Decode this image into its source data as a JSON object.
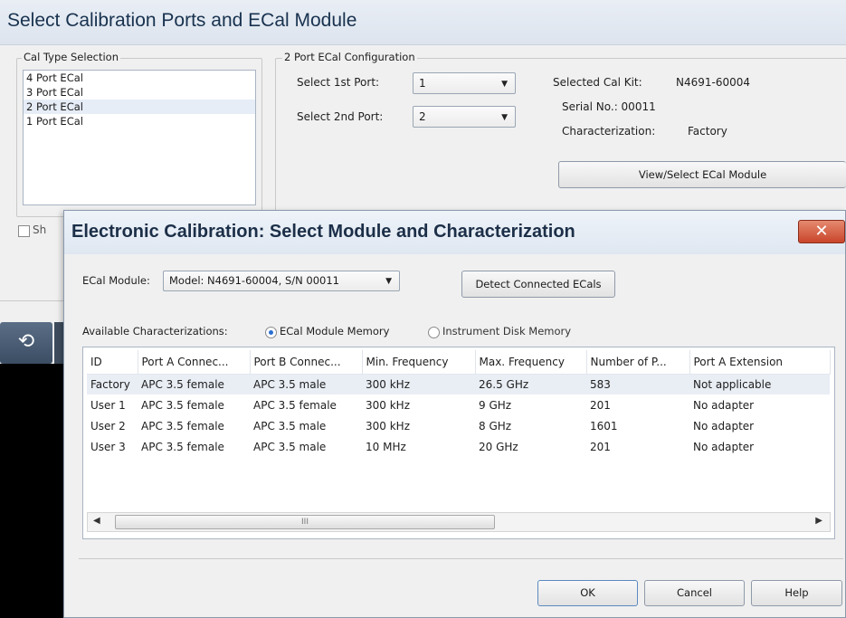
{
  "background_window": {
    "title": "Select Calibration Ports and ECal Module",
    "cal_type_group": {
      "title": "Cal Type Selection",
      "items": [
        "4 Port ECal",
        "3 Port ECal",
        "2 Port ECal",
        "1 Port ECal"
      ],
      "selected_index": 2
    },
    "config_group": {
      "title": "2 Port ECal Configuration",
      "port1_label": "Select 1st Port:",
      "port1_value": "1",
      "port2_label": "Select 2nd Port:",
      "port2_value": "2"
    },
    "cal_kit": {
      "selected_label": "Selected Cal Kit:",
      "selected_value": "N4691-60004",
      "serial_label": "Serial No.: 00011",
      "characterization_label": "Characterization:",
      "characterization_value": "Factory",
      "view_select_button": "View/Select ECal Module"
    },
    "checkbox_label_partial": "Sh"
  },
  "dialog": {
    "title": "Electronic Calibration: Select Module and Characterization",
    "close_glyph": "✕",
    "ecal_module_label": "ECal Module:",
    "ecal_module_value": "Model: N4691-60004, S/N 00011",
    "detect_button": "Detect Connected ECals",
    "available_label": "Available Characterizations:",
    "radio_ecal_memory": "ECal Module Memory",
    "radio_disk_memory": "Instrument Disk Memory",
    "radio_selected": "ECal Module Memory",
    "table": {
      "columns": [
        "ID",
        "Port A Connec...",
        "Port B Connec...",
        "Min. Frequency",
        "Max. Frequency",
        "Number of P...",
        "Port A Extension"
      ],
      "rows": [
        [
          "Factory",
          "APC 3.5 female",
          "APC 3.5 male",
          "300 kHz",
          "26.5 GHz",
          "583",
          "Not applicable"
        ],
        [
          "User 1",
          "APC 3.5 female",
          "APC 3.5 female",
          "300 kHz",
          "9 GHz",
          "201",
          "No adapter"
        ],
        [
          "User 2",
          "APC 3.5 female",
          "APC 3.5 male",
          "300 kHz",
          "8 GHz",
          "1601",
          "No adapter"
        ],
        [
          "User 3",
          "APC 3.5 female",
          "APC 3.5 male",
          "10 MHz",
          "20 GHz",
          "201",
          "No adapter"
        ]
      ],
      "selected_row": 0
    },
    "scrollbar_grip": "III",
    "buttons": {
      "ok": "OK",
      "cancel": "Cancel",
      "help": "Help"
    }
  },
  "icons": {
    "undo": "undo-arrow-icon",
    "close": "close-x-icon",
    "dropdown": "chevron-down-icon"
  },
  "colors": {
    "close_button": "#c9452a",
    "selection": "#e9eef5",
    "radio_dot": "#2a6fd0"
  }
}
